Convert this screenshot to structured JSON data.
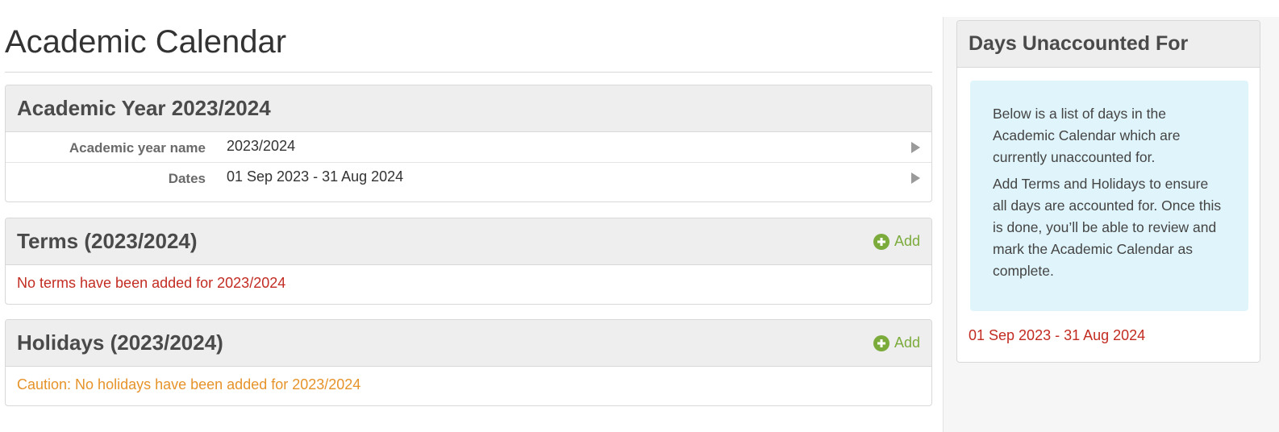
{
  "page": {
    "title": "Academic Calendar"
  },
  "academic_year": {
    "title": "Academic Year 2023/2024",
    "rows": [
      {
        "label": "Academic year name",
        "value": "2023/2024"
      },
      {
        "label": "Dates",
        "value": "01 Sep 2023 - 31 Aug 2024"
      }
    ]
  },
  "terms": {
    "title": "Terms (2023/2024)",
    "add_label": "Add",
    "message": "No terms have been added for 2023/2024"
  },
  "holidays": {
    "title": "Holidays (2023/2024)",
    "add_label": "Add",
    "message": "Caution: No holidays have been added for 2023/2024"
  },
  "sidebar": {
    "title": "Days Unaccounted For",
    "info_paragraphs": [
      "Below is a list of days in the Academic Calendar which are currently unaccounted for.",
      "Add Terms and Holidays to ensure all days are accounted for. Once this is done, you’ll be able to review and mark the Academic Calendar as complete."
    ],
    "unaccounted_dates": "01 Sep 2023 - 31 Aug 2024"
  },
  "colors": {
    "accent_green": "#7bab3b",
    "error_red": "#c22c22",
    "warning_orange": "#e6932a",
    "info_bg": "#e0f5fb"
  },
  "icons": {
    "add": "plus-circle-icon",
    "row_arrow": "caret-right-icon"
  }
}
